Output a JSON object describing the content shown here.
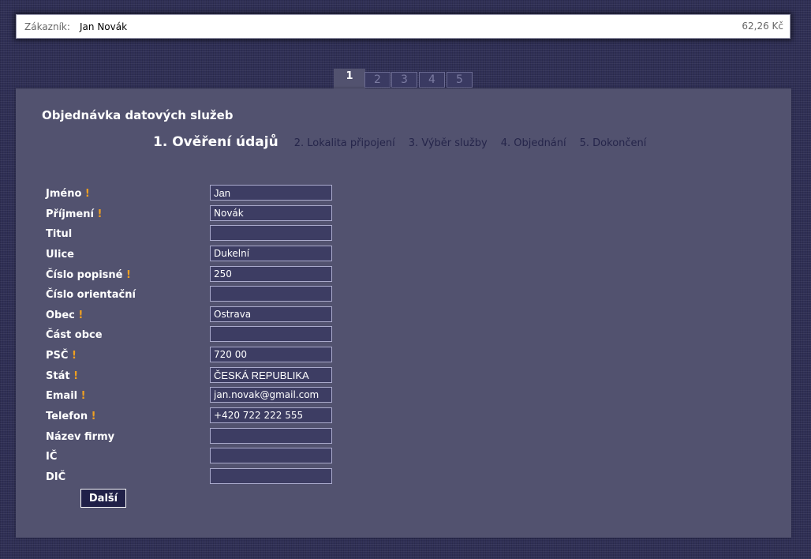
{
  "header": {
    "customer_label": "Zákazník:",
    "customer_name": "Jan Novák",
    "price": "62,26 Kč"
  },
  "tabs": [
    "1",
    "2",
    "3",
    "4",
    "5"
  ],
  "page": {
    "title": "Objednávka datových služeb",
    "steps": [
      "1. Ověření údajů",
      "2. Lokalita připojení",
      "3. Výběr služby",
      "4. Objednání",
      "5. Dokončení"
    ]
  },
  "form": {
    "required_mark": "!",
    "fields": [
      {
        "label": "Jméno",
        "required": true,
        "value": "Jan"
      },
      {
        "label": "Příjmení",
        "required": true,
        "value": "Novák"
      },
      {
        "label": "Titul",
        "required": false,
        "value": ""
      },
      {
        "label": "Ulice",
        "required": false,
        "value": "Dukelní"
      },
      {
        "label": "Číslo popisné",
        "required": true,
        "value": "250"
      },
      {
        "label": "Číslo orientační",
        "required": false,
        "value": ""
      },
      {
        "label": "Obec",
        "required": true,
        "value": "Ostrava"
      },
      {
        "label": "Část obce",
        "required": false,
        "value": ""
      },
      {
        "label": "PSČ",
        "required": true,
        "value": "720 00"
      },
      {
        "label": "Stát",
        "required": true,
        "value": "ČESKÁ REPUBLIKA"
      },
      {
        "label": "Email",
        "required": true,
        "value": "jan.novak@gmail.com"
      },
      {
        "label": "Telefon",
        "required": true,
        "value": "+420 722 222 555"
      },
      {
        "label": "Název firmy",
        "required": false,
        "value": ""
      },
      {
        "label": "IČ",
        "required": false,
        "value": ""
      },
      {
        "label": "DIČ",
        "required": false,
        "value": ""
      }
    ],
    "next_label": "Další"
  },
  "colors": {
    "background": "#2f2f55",
    "panel": "#52526f",
    "required_mark": "#f0a020",
    "step_inactive": "#25254a"
  }
}
